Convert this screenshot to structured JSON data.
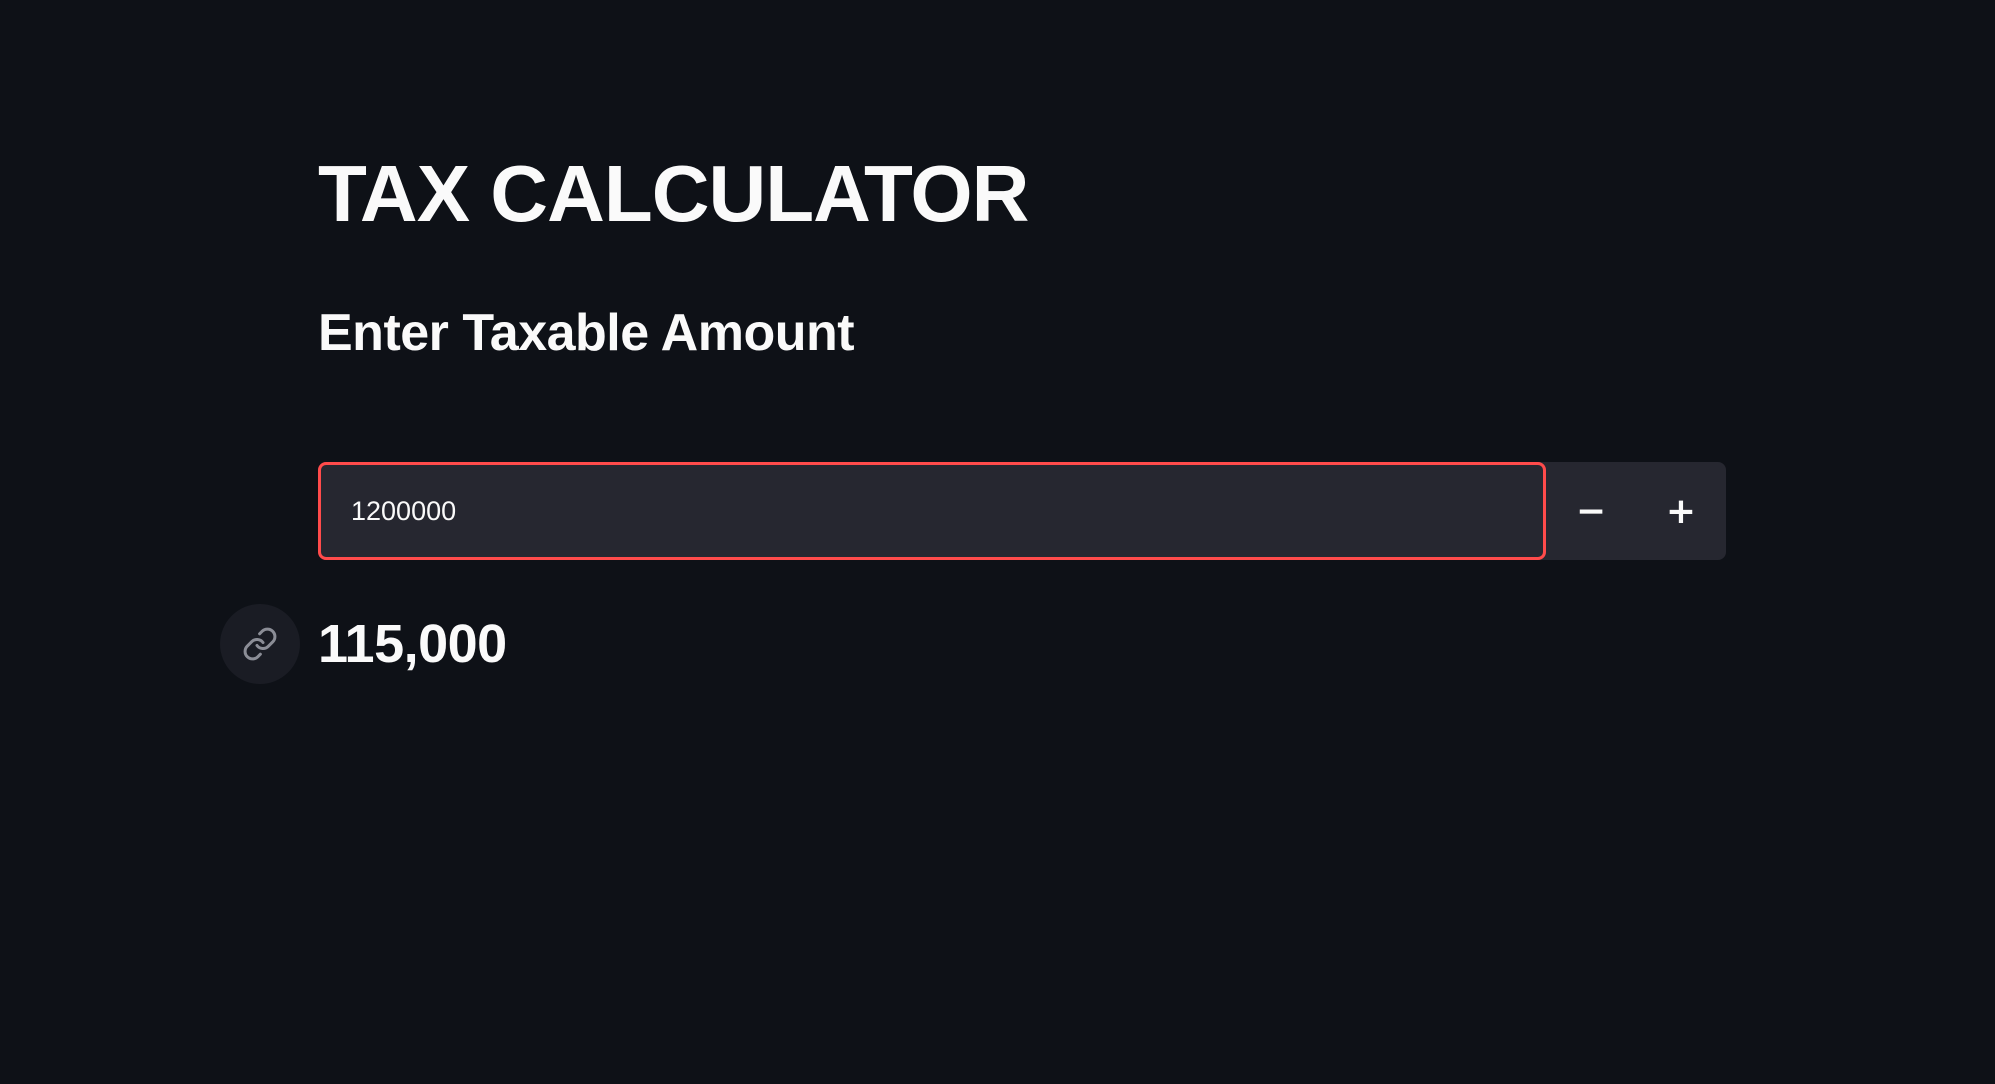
{
  "header": {
    "title": "TAX CALCULATOR",
    "subtitle": "Enter Taxable Amount"
  },
  "amount_input": {
    "value": "1200000",
    "decrement_label": "−",
    "increment_label": "+"
  },
  "result": {
    "value": "115,000",
    "link_icon": "link-icon"
  },
  "colors": {
    "background": "#0e1117",
    "input_background": "#262730",
    "accent_border": "#ff4b4b",
    "text": "#fafafa"
  }
}
